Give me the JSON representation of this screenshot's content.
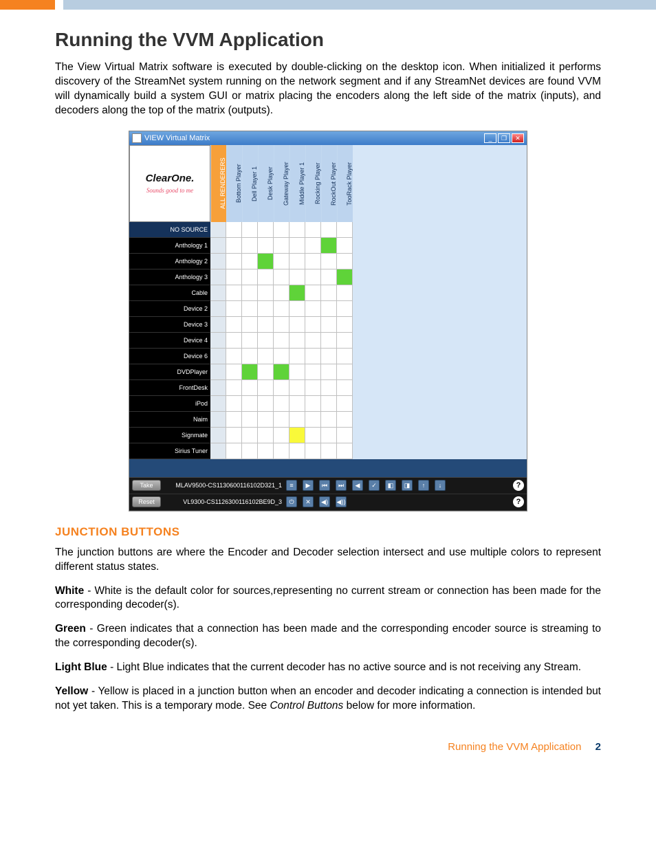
{
  "heading": "Running the VVM Application",
  "intro": "The View Virtual Matrix software is executed by double-clicking on the desktop icon. When initialized it performs discovery of the StreamNet system running on the network segment and if any StreamNet devices are found VVM will dynamically build a system GUI or matrix placing the encoders along the left side of the matrix (inputs), and decoders along the top of the matrix (outputs).",
  "screenshot": {
    "window_title": "VIEW Virtual Matrix",
    "logo_brand": "ClearOne.",
    "logo_tagline": "Sounds good to me",
    "col_headers": [
      "ALL RENDERERS",
      "Bottom Player",
      "Dell Player 1",
      "Desk Player",
      "Gateway Player",
      "Middle Player 1",
      "Rocking Player",
      "RockOut Player",
      "TooRack Player"
    ],
    "row_headers": [
      "NO SOURCE",
      "Anthology 1",
      "Anthology 2",
      "Anthology 3",
      "Cable",
      "Device 2",
      "Device 3",
      "Device 4",
      "Device 6",
      "DVDPlayer",
      "FrontDesk",
      "iPod",
      "Naim",
      "Signmate",
      "Sirius Tuner"
    ],
    "green_cells": [
      [
        1,
        7
      ],
      [
        2,
        3
      ],
      [
        3,
        8
      ],
      [
        4,
        5
      ],
      [
        9,
        2
      ],
      [
        9,
        4
      ]
    ],
    "yellow_cells": [
      [
        13,
        5
      ]
    ],
    "take_label": "Take",
    "reset_label": "Reset",
    "status_line_1": "MLAV9500-CS1130600116102D321_1",
    "status_line_2": "VL9300-CS1126300116102BE9D_3"
  },
  "subhead": "JUNCTION BUTTONS",
  "para_intro": "The junction buttons are where the Encoder and Decoder selection intersect and use multiple colors to represent different status states.",
  "white_lead": "White",
  "white_body": " - White is the default color for sources,representing no current stream or connection has been made for the corresponding decoder(s).",
  "green_lead": "Green",
  "green_body": " - Green indicates that a connection has been made and the corresponding encoder source is streaming to the corresponding decoder(s).",
  "lb_lead": "Light Blue",
  "lb_body": " - Light Blue indicates that the current decoder has no active source and is not receiving any Stream.",
  "yellow_lead": "Yellow",
  "yellow_body_a": " - Yellow is placed in a junction button when an encoder and decoder indicating a connection is intended but not yet taken. This is a temporary mode. See ",
  "yellow_ital": "Control Buttons",
  "yellow_body_b": " below for more information.",
  "footer_title": "Running the VVM Application",
  "footer_page": "2"
}
